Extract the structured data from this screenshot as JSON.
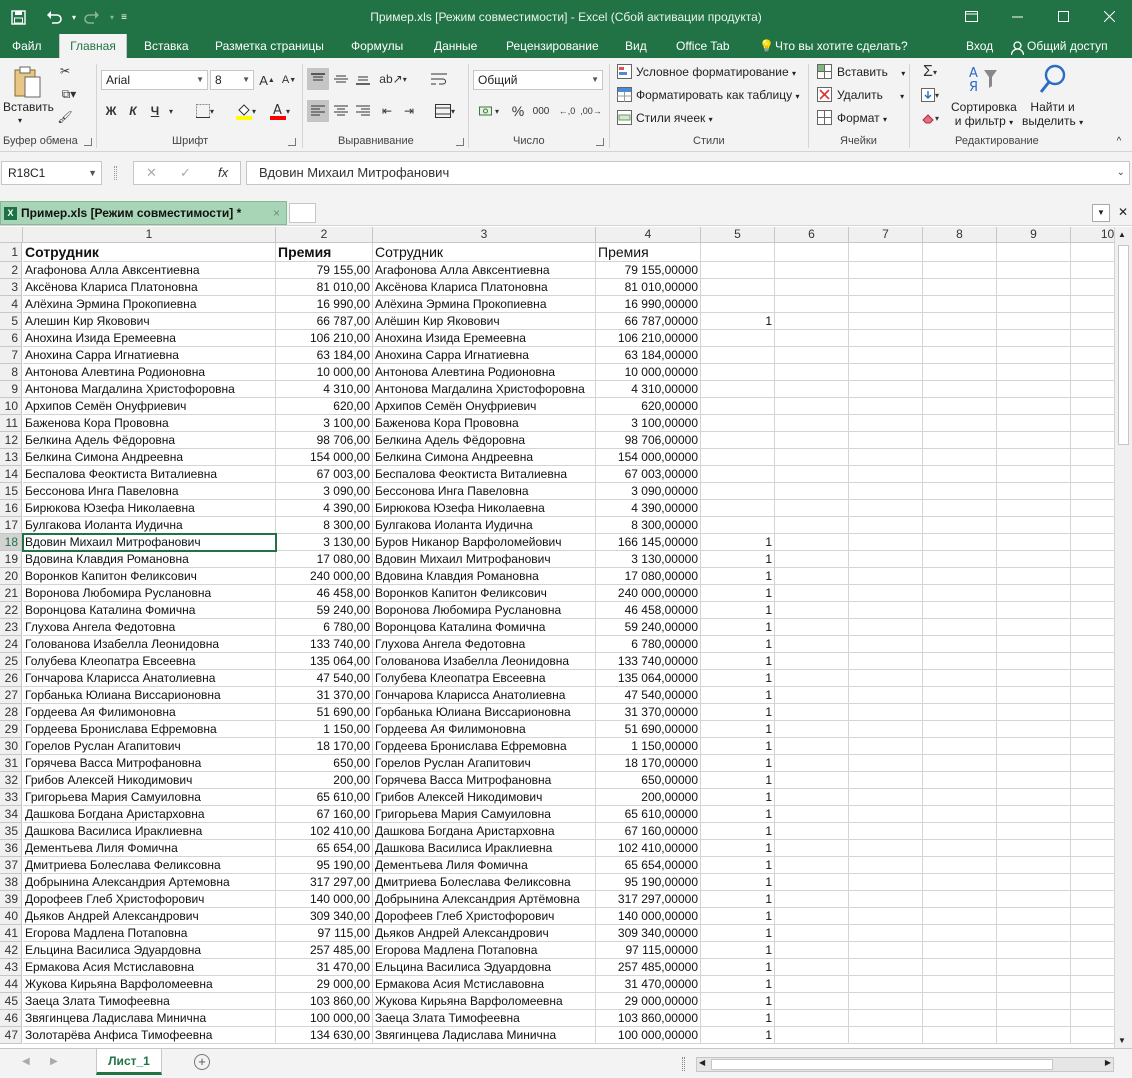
{
  "window": {
    "title": "Пример.xls  [Режим совместимости] - Excel (Сбой активации продукта)",
    "icons": [
      "save-icon",
      "undo-icon",
      "redo-icon",
      "customize-icon",
      "ribbon-display-icon",
      "minimize-icon",
      "maximize-icon",
      "close-icon"
    ]
  },
  "tabs": [
    {
      "label": "Файл"
    },
    {
      "label": "Главная"
    },
    {
      "label": "Вставка"
    },
    {
      "label": "Разметка страницы"
    },
    {
      "label": "Формулы"
    },
    {
      "label": "Данные"
    },
    {
      "label": "Рецензирование"
    },
    {
      "label": "Вид"
    },
    {
      "label": "Office Tab"
    },
    {
      "label": "Что вы хотите сделать?"
    },
    {
      "label": "Вход"
    },
    {
      "label": "Общий доступ"
    }
  ],
  "ribbon": {
    "clipboard": {
      "paste": "Вставить",
      "group": "Буфер обмена"
    },
    "font": {
      "name": "Arial",
      "size": "8",
      "bold": "Ж",
      "italic": "К",
      "underline": "Ч",
      "group": "Шрифт"
    },
    "alignment": {
      "group": "Выравнивание"
    },
    "number": {
      "format": "Общий",
      "percent": "%",
      "thousands": "000",
      "group": "Число"
    },
    "styles": {
      "conditional": "Условное форматирование",
      "as_table": "Форматировать как таблицу",
      "cell_styles": "Стили ячеек",
      "group": "Стили"
    },
    "cells": {
      "insert": "Вставить",
      "delete": "Удалить",
      "format": "Формат",
      "group": "Ячейки"
    },
    "editing": {
      "sort": "Сортировка",
      "sort2": "и фильтр",
      "find": "Найти и",
      "find2": "выделить",
      "group": "Редактирование"
    }
  },
  "formula_bar": {
    "name_box": "R18C1",
    "cancel": "✕",
    "enter": "✓",
    "fx": "fx",
    "value": "Вдовин Михаил Митрофанович"
  },
  "workbook_tab": {
    "label": "Пример.xls  [Режим совместимости] *",
    "close": "×",
    "badge": "X"
  },
  "columns": [
    "1",
    "2",
    "3",
    "4",
    "5",
    "6",
    "7",
    "8",
    "9",
    "10"
  ],
  "header_row": {
    "c1": "Сотрудник",
    "c2": "Премия",
    "c3": "Сотрудник",
    "c4": "Премия"
  },
  "rows": [
    {
      "n": "2",
      "c1": "Агафонова Алла Авксентиевна",
      "c2": "79 155,00",
      "c3": "Агафонова Алла Авксентиевна",
      "c4": "79 155,00000",
      "c5": ""
    },
    {
      "n": "3",
      "c1": "Аксёнова Клариса Платоновна",
      "c2": "81 010,00",
      "c3": "Аксёнова Клариса Платоновна",
      "c4": "81 010,00000",
      "c5": ""
    },
    {
      "n": "4",
      "c1": "Алёхина Эрмина Прокопиевна",
      "c2": "16 990,00",
      "c3": "Алёхина Эрмина Прокопиевна",
      "c4": "16 990,00000",
      "c5": ""
    },
    {
      "n": "5",
      "c1": "Алешин Кир Яковович",
      "c2": "66 787,00",
      "c3": "Алёшин Кир Яковович",
      "c4": "66 787,00000",
      "c5": "1"
    },
    {
      "n": "6",
      "c1": "Анохина Изида Еремеевна",
      "c2": "106 210,00",
      "c3": "Анохина Изида Еремеевна",
      "c4": "106 210,00000",
      "c5": ""
    },
    {
      "n": "7",
      "c1": "Анохина Сарра Игнатиевна",
      "c2": "63 184,00",
      "c3": "Анохина Сарра Игнатиевна",
      "c4": "63 184,00000",
      "c5": ""
    },
    {
      "n": "8",
      "c1": "Антонова Алевтина Родионовна",
      "c2": "10 000,00",
      "c3": "Антонова Алевтина Родионовна",
      "c4": "10 000,00000",
      "c5": ""
    },
    {
      "n": "9",
      "c1": "Антонова Магдалина Христофоровна",
      "c2": "4 310,00",
      "c3": "Антонова Магдалина Христофоровна",
      "c4": "4 310,00000",
      "c5": ""
    },
    {
      "n": "10",
      "c1": "Архипов Семён Онуфриевич",
      "c2": "620,00",
      "c3": "Архипов Семён Онуфриевич",
      "c4": "620,00000",
      "c5": ""
    },
    {
      "n": "11",
      "c1": "Баженова Кора Прововна",
      "c2": "3 100,00",
      "c3": "Баженова Кора Прововна",
      "c4": "3 100,00000",
      "c5": ""
    },
    {
      "n": "12",
      "c1": "Белкина Адель Фёдоровна",
      "c2": "98 706,00",
      "c3": "Белкина Адель Фёдоровна",
      "c4": "98 706,00000",
      "c5": ""
    },
    {
      "n": "13",
      "c1": "Белкина Симона Андреевна",
      "c2": "154 000,00",
      "c3": "Белкина Симона Андреевна",
      "c4": "154 000,00000",
      "c5": ""
    },
    {
      "n": "14",
      "c1": "Беспалова Феоктиста Виталиевна",
      "c2": "67 003,00",
      "c3": "Беспалова Феоктиста Виталиевна",
      "c4": "67 003,00000",
      "c5": ""
    },
    {
      "n": "15",
      "c1": "Бессонова Инга Павеловна",
      "c2": "3 090,00",
      "c3": "Бессонова Инга Павеловна",
      "c4": "3 090,00000",
      "c5": ""
    },
    {
      "n": "16",
      "c1": "Бирюкова Юзефа Николаевна",
      "c2": "4 390,00",
      "c3": "Бирюкова Юзефа Николаевна",
      "c4": "4 390,00000",
      "c5": ""
    },
    {
      "n": "17",
      "c1": "Булгакова Иоланта Иудична",
      "c2": "8 300,00",
      "c3": "Булгакова Иоланта Иудична",
      "c4": "8 300,00000",
      "c5": ""
    },
    {
      "n": "18",
      "c1": "Вдовин Михаил Митрофанович",
      "c2": "3 130,00",
      "c3": "Буров Никанор Варфоломейович",
      "c4": "166 145,00000",
      "c5": "1"
    },
    {
      "n": "19",
      "c1": "Вдовина Клавдия Романовна",
      "c2": "17 080,00",
      "c3": "Вдовин Михаил Митрофанович",
      "c4": "3 130,00000",
      "c5": "1"
    },
    {
      "n": "20",
      "c1": "Воронков Капитон Феликсович",
      "c2": "240 000,00",
      "c3": "Вдовина Клавдия Романовна",
      "c4": "17 080,00000",
      "c5": "1"
    },
    {
      "n": "21",
      "c1": "Воронова Любомира Руслановна",
      "c2": "46 458,00",
      "c3": "Воронков Капитон Феликсович",
      "c4": "240 000,00000",
      "c5": "1"
    },
    {
      "n": "22",
      "c1": "Воронцова Каталина Фомична",
      "c2": "59 240,00",
      "c3": "Воронова Любомира Руслановна",
      "c4": "46 458,00000",
      "c5": "1"
    },
    {
      "n": "23",
      "c1": "Глухова Ангела Федотовна",
      "c2": "6 780,00",
      "c3": "Воронцова Каталина Фомична",
      "c4": "59 240,00000",
      "c5": "1"
    },
    {
      "n": "24",
      "c1": "Голованова Изабелла Леонидовна",
      "c2": "133 740,00",
      "c3": "Глухова Ангела Федотовна",
      "c4": "6 780,00000",
      "c5": "1"
    },
    {
      "n": "25",
      "c1": "Голубева Клеопатра Евсеевна",
      "c2": "135 064,00",
      "c3": "Голованова Изабелла Леонидовна",
      "c4": "133 740,00000",
      "c5": "1"
    },
    {
      "n": "26",
      "c1": "Гончарова Кларисса Анатолиевна",
      "c2": "47 540,00",
      "c3": "Голубева Клеопатра Евсеевна",
      "c4": "135 064,00000",
      "c5": "1"
    },
    {
      "n": "27",
      "c1": "Горбанька Юлиана Виссарионовна",
      "c2": "31 370,00",
      "c3": "Гончарова Кларисса Анатолиевна",
      "c4": "47 540,00000",
      "c5": "1"
    },
    {
      "n": "28",
      "c1": "Гордеева Ая Филимоновна",
      "c2": "51 690,00",
      "c3": "Горбанька Юлиана Виссарионовна",
      "c4": "31 370,00000",
      "c5": "1"
    },
    {
      "n": "29",
      "c1": "Гордеева Бронислава Ефремовна",
      "c2": "1 150,00",
      "c3": "Гордеева Ая Филимоновна",
      "c4": "51 690,00000",
      "c5": "1"
    },
    {
      "n": "30",
      "c1": "Горелов Руслан Агапитович",
      "c2": "18 170,00",
      "c3": "Гордеева Бронислава Ефремовна",
      "c4": "1 150,00000",
      "c5": "1"
    },
    {
      "n": "31",
      "c1": "Горячева Васса Митрофановна",
      "c2": "650,00",
      "c3": "Горелов Руслан Агапитович",
      "c4": "18 170,00000",
      "c5": "1"
    },
    {
      "n": "32",
      "c1": "Грибов Алексей Никодимович",
      "c2": "200,00",
      "c3": "Горячева Васса Митрофановна",
      "c4": "650,00000",
      "c5": "1"
    },
    {
      "n": "33",
      "c1": "Григорьева Мария Самуиловна",
      "c2": "65 610,00",
      "c3": "Грибов Алексей Никодимович",
      "c4": "200,00000",
      "c5": "1"
    },
    {
      "n": "34",
      "c1": "Дашкова Богдана Аристарховна",
      "c2": "67 160,00",
      "c3": "Григорьева Мария Самуиловна",
      "c4": "65 610,00000",
      "c5": "1"
    },
    {
      "n": "35",
      "c1": "Дашкова Василиса Ираклиевна",
      "c2": "102 410,00",
      "c3": "Дашкова Богдана Аристарховна",
      "c4": "67 160,00000",
      "c5": "1"
    },
    {
      "n": "36",
      "c1": "Дементьева Лиля Фомична",
      "c2": "65 654,00",
      "c3": "Дашкова Василиса Ираклиевна",
      "c4": "102 410,00000",
      "c5": "1"
    },
    {
      "n": "37",
      "c1": "Дмитриева Болеслава Феликсовна",
      "c2": "95 190,00",
      "c3": "Дементьева Лиля Фомична",
      "c4": "65 654,00000",
      "c5": "1"
    },
    {
      "n": "38",
      "c1": "Добрынина Александрия Артемовна",
      "c2": "317 297,00",
      "c3": "Дмитриева Болеслава Феликсовна",
      "c4": "95 190,00000",
      "c5": "1"
    },
    {
      "n": "39",
      "c1": "Дорофеев Глеб Христофорович",
      "c2": "140 000,00",
      "c3": "Добрынина Александрия Артёмовна",
      "c4": "317 297,00000",
      "c5": "1"
    },
    {
      "n": "40",
      "c1": "Дьяков Андрей Александрович",
      "c2": "309 340,00",
      "c3": "Дорофеев Глеб Христофорович",
      "c4": "140 000,00000",
      "c5": "1"
    },
    {
      "n": "41",
      "c1": "Егорова Мадлена Потаповна",
      "c2": "97 115,00",
      "c3": "Дьяков Андрей Александрович",
      "c4": "309 340,00000",
      "c5": "1"
    },
    {
      "n": "42",
      "c1": "Ельцина Василиса Эдуардовна",
      "c2": "257 485,00",
      "c3": "Егорова Мадлена Потаповна",
      "c4": "97 115,00000",
      "c5": "1"
    },
    {
      "n": "43",
      "c1": "Ермакова Асия Мстиславовна",
      "c2": "31 470,00",
      "c3": "Ельцина Василиса Эдуардовна",
      "c4": "257 485,00000",
      "c5": "1"
    },
    {
      "n": "44",
      "c1": "Жукова Кирьяна Варфоломеевна",
      "c2": "29 000,00",
      "c3": "Ермакова Асия Мстиславовна",
      "c4": "31 470,00000",
      "c5": "1"
    },
    {
      "n": "45",
      "c1": "Заеца Злата Тимофеевна",
      "c2": "103 860,00",
      "c3": "Жукова Кирьяна Варфоломеевна",
      "c4": "29 000,00000",
      "c5": "1"
    },
    {
      "n": "46",
      "c1": "Звягинцева Ладислава Миничнa",
      "c2": "100 000,00",
      "c3": "Заеца Злата Тимофеевна",
      "c4": "103 860,00000",
      "c5": "1"
    },
    {
      "n": "47",
      "c1": "Золотарёва Анфиса Тимофеевна",
      "c2": "134 630,00",
      "c3": "Звягинцева Ладислава Миничнa",
      "c4": "100 000,00000",
      "c5": "1"
    }
  ],
  "sheet_tabs": [
    {
      "label": "Лист_1"
    }
  ],
  "colors": {
    "accent": "#217346",
    "selection": "#217346"
  }
}
